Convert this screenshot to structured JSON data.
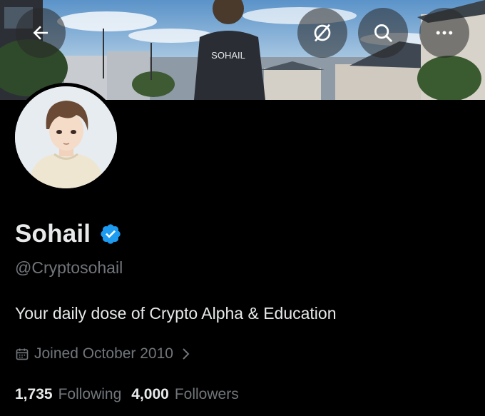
{
  "header": {
    "back_icon": "arrow-left-icon",
    "grok_icon": "grok-slash-circle-icon",
    "search_icon": "search-icon",
    "more_icon": "more-horizontal-icon",
    "banner_shirt_text": "SOHAIL"
  },
  "profile": {
    "display_name": "Sohail",
    "verified": true,
    "verified_color": "#1d9bf0",
    "handle": "@Cryptosohail",
    "bio": "Your daily dose of Crypto Alpha & Education",
    "joined": "Joined October 2010",
    "following_count": "1,735",
    "following_label": "Following",
    "followers_count": "4,000",
    "followers_label": "Followers"
  },
  "colors": {
    "background": "#000000",
    "text_primary": "#e7e9ea",
    "text_secondary": "#71767b"
  }
}
